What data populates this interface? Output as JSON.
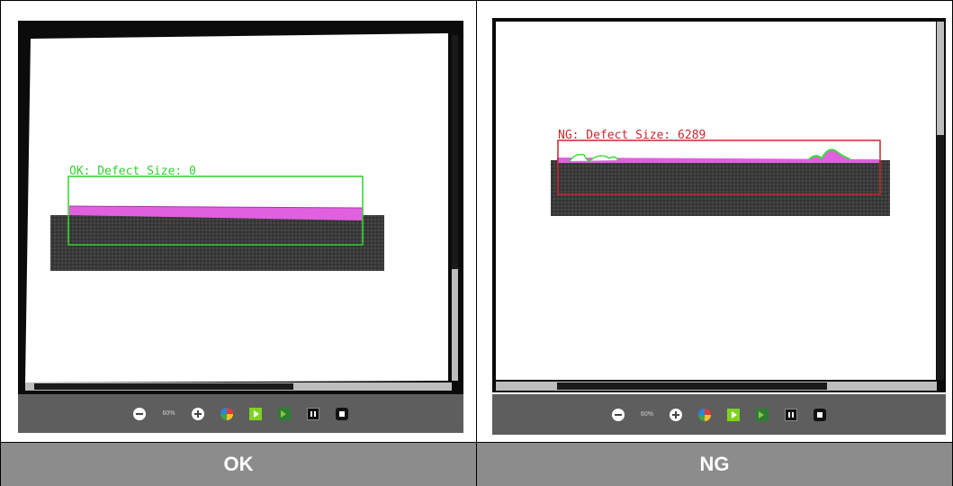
{
  "panels": {
    "left": {
      "overlay_text": "OK: Defect Size: 0",
      "zoom_label": "60%",
      "status_label": "OK",
      "colors": {
        "box": "#2fd12f",
        "defect": "#e060e0"
      }
    },
    "right": {
      "overlay_text": "NG: Defect Size: 6289",
      "zoom_label": "60%",
      "status_label": "NG",
      "colors": {
        "box": "#c8262e",
        "defect": "#e060e0",
        "edge": "#3ddc3d"
      }
    }
  },
  "toolbar_icons": [
    "zoom-out-icon",
    "zoom-level",
    "zoom-in-icon",
    "color-wheel-icon",
    "play-icon",
    "step-icon",
    "pause-icon",
    "stop-icon"
  ]
}
